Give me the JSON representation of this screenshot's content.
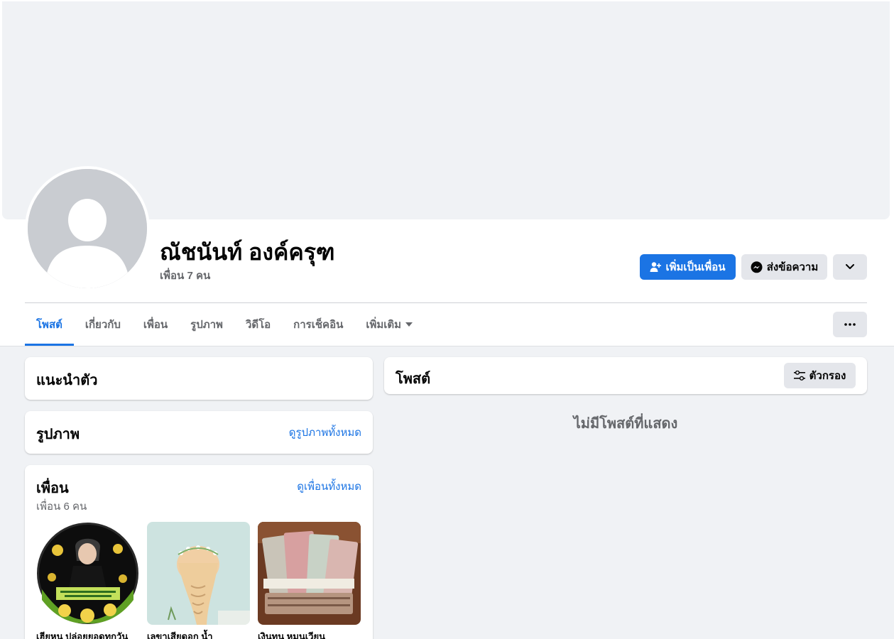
{
  "profile": {
    "name": "ณัชนันท์ องค์ครุฑ",
    "friend_count": "เพื่อน 7 คน"
  },
  "actions": {
    "add_friend": "เพิ่มเป็นเพื่อน",
    "message": "ส่งข้อความ"
  },
  "tabs": [
    {
      "label": "โพสต์"
    },
    {
      "label": "เกี่ยวกับ"
    },
    {
      "label": "เพื่อน"
    },
    {
      "label": "รูปภาพ"
    },
    {
      "label": "วิดีโอ"
    },
    {
      "label": "การเช็คอิน"
    },
    {
      "label": "เพิ่มเติม"
    }
  ],
  "intro": {
    "title": "แนะนำตัว"
  },
  "photos": {
    "title": "รูปภาพ",
    "see_all": "ดูรูปภาพทั้งหมด"
  },
  "friends": {
    "title": "เพื่อน",
    "see_all": "ดูเพื่อนทั้งหมด",
    "count": "เพื่อน 6 คน",
    "items": [
      {
        "name": "เฮียหนู ปล่อยยอดทุกวัน"
      },
      {
        "name": "เลขาเสียดอก น้ำ"
      },
      {
        "name": "เงินทุน หมุนเวียน"
      }
    ]
  },
  "posts": {
    "title": "โพสต์",
    "filter": "ตัวกรอง",
    "empty": "ไม่มีโพสต์ที่แสดง"
  },
  "colors": {
    "accent": "#1b74e4",
    "background": "#f0f2f5",
    "secondary_button": "#e4e6eb"
  },
  "icons": [
    "add-friend-icon",
    "messenger-icon",
    "chevron-down-icon",
    "more-icon",
    "caret-down-icon",
    "filter-icon"
  ]
}
